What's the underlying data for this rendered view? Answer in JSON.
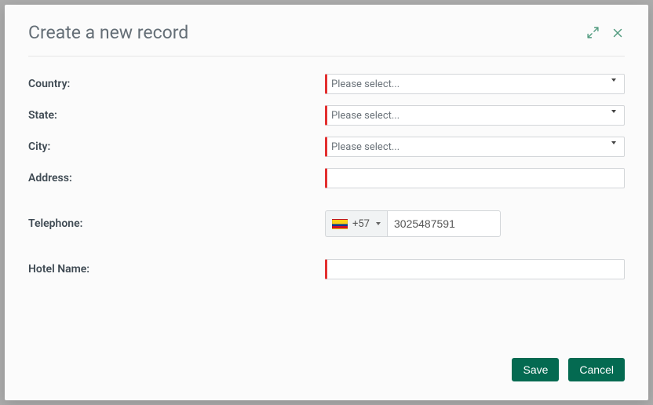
{
  "header": {
    "title": "Create a new record"
  },
  "fields": {
    "country": {
      "label": "Country:",
      "placeholder": "Please select..."
    },
    "state": {
      "label": "State:",
      "placeholder": "Please select..."
    },
    "city": {
      "label": "City:",
      "placeholder": "Please select..."
    },
    "address": {
      "label": "Address:",
      "value": ""
    },
    "telephone": {
      "label": "Telephone:",
      "dial_code": "+57",
      "flag": "colombia",
      "value": "3025487591"
    },
    "hotel_name": {
      "label": "Hotel Name:",
      "value": ""
    }
  },
  "footer": {
    "save_label": "Save",
    "cancel_label": "Cancel"
  }
}
